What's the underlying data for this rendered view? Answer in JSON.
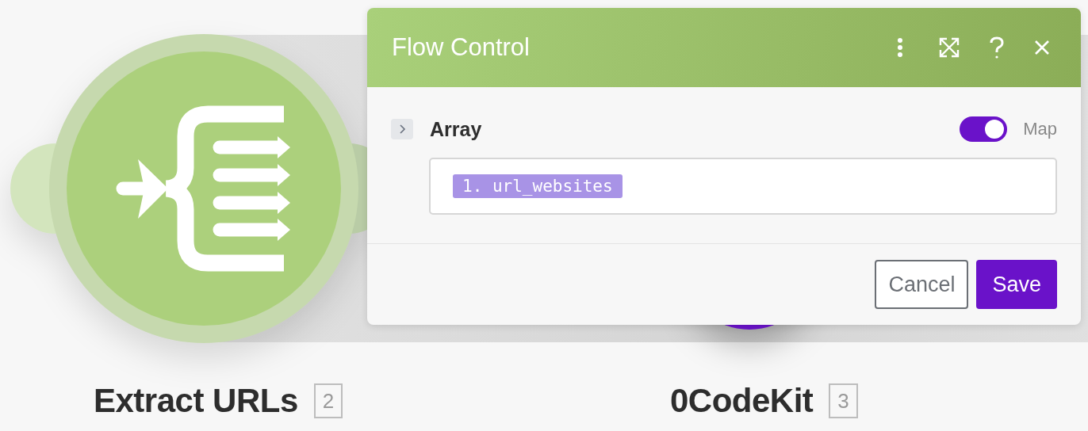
{
  "canvas": {
    "modules": [
      {
        "label": "Extract URLs",
        "number": "2"
      },
      {
        "label": "0CodeKit",
        "number": "3"
      }
    ]
  },
  "dialog": {
    "title": "Flow Control",
    "fields": [
      {
        "label": "Array",
        "expanded": false,
        "map": {
          "label": "Map",
          "on": true
        },
        "token": "1. url_websites"
      }
    ],
    "buttons": [
      {
        "label": "Cancel",
        "kind": "secondary"
      },
      {
        "label": "Save",
        "kind": "primary"
      }
    ]
  }
}
